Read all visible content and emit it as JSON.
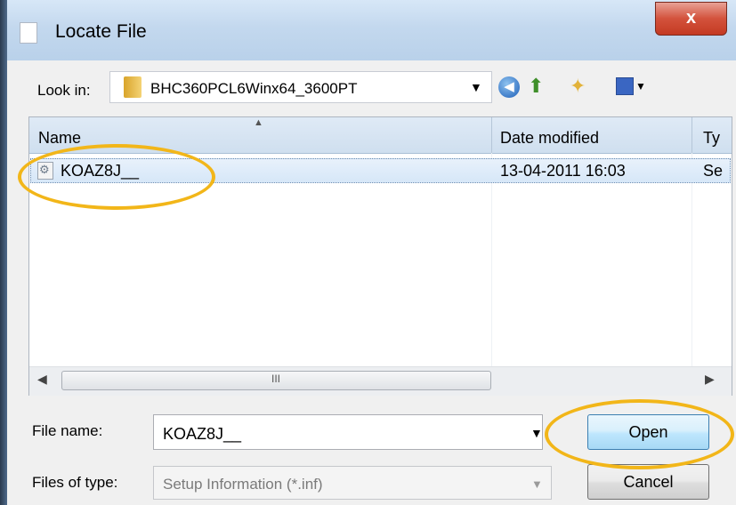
{
  "window": {
    "title": "Locate File",
    "close_label": "x"
  },
  "toolbar": {
    "look_in_label": "Look in:",
    "look_in_value": "BHC360PCL6Winx64_3600PT",
    "icons": [
      "back-icon",
      "up-folder-icon",
      "new-folder-icon",
      "view-menu-icon"
    ]
  },
  "file_list": {
    "columns": [
      "Name",
      "Date modified",
      "Ty"
    ],
    "rows": [
      {
        "name": "KOAZ8J__",
        "date_modified": "13-04-2011 16:03",
        "type": "Se"
      }
    ],
    "scroll_grip": "III"
  },
  "form": {
    "file_name_label": "File name:",
    "file_name_value": "KOAZ8J__",
    "file_type_label": "Files of type:",
    "file_type_value": "Setup Information (*.inf)",
    "open_label": "Open",
    "cancel_label": "Cancel"
  },
  "colors": {
    "highlight": "#f2b619",
    "selection": "#d6e7f8"
  }
}
